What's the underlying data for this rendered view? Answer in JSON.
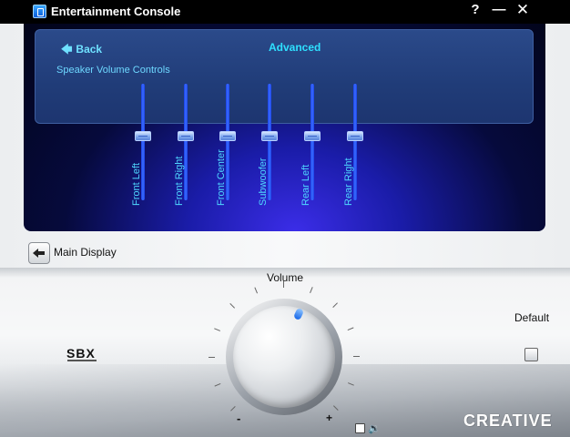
{
  "window": {
    "title": "Entertainment Console",
    "help": "?",
    "minimize": "—",
    "close": "✕"
  },
  "display": {
    "back_label": "Back",
    "mode_label": "Advanced",
    "section_label": "Speaker Volume Controls",
    "channels": [
      {
        "label": "Front Left",
        "level": 0.5
      },
      {
        "label": "Front Right",
        "level": 0.5
      },
      {
        "label": "Front Center",
        "level": 0.5
      },
      {
        "label": "Subwoofer",
        "level": 0.5
      },
      {
        "label": "Rear Left",
        "level": 0.5
      },
      {
        "label": "Rear Right",
        "level": 0.5
      }
    ]
  },
  "nav": {
    "main_display_label": "Main Display"
  },
  "controls": {
    "volume_label": "Volume",
    "volume_min": "-",
    "volume_max": "+",
    "sbx_label": "SBX",
    "default_label": "Default",
    "mute_icon": "speaker-icon"
  },
  "brand": {
    "name": "CREATIVE"
  },
  "colors": {
    "accent": "#2ee0ff",
    "slider": "#3b6dff",
    "display_bg": "#060a3c"
  }
}
